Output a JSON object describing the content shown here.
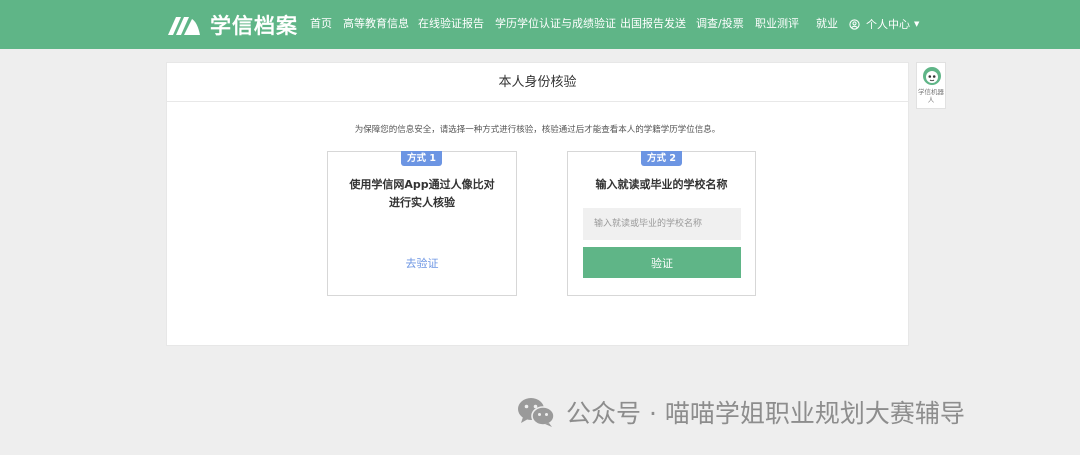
{
  "brand": {
    "name": "学信档案",
    "color": "#5fb587"
  },
  "nav": {
    "items": [
      {
        "id": "home",
        "label": "首页"
      },
      {
        "id": "higher-edu",
        "label": "高等教育信息"
      },
      {
        "id": "online-report",
        "label": "在线验证报告"
      },
      {
        "id": "cert",
        "label": "学历学位认证与成绩验证"
      },
      {
        "id": "abroad",
        "label": "出国报告发送"
      },
      {
        "id": "survey",
        "label": "调查/投票"
      },
      {
        "id": "career",
        "label": "职业测评"
      },
      {
        "id": "job",
        "label": "就业"
      }
    ],
    "user_menu": {
      "label": "个人中心",
      "icon": "user-circle-icon"
    }
  },
  "page": {
    "title": "本人身份核验",
    "notice": "为保障您的信息安全，请选择一种方式进行核验，核验通过后才能查看本人的学籍学历学位信息。"
  },
  "methods": [
    {
      "badge": "方式 1",
      "title": "使用学信网App通过人像比对进行实人核验",
      "link": "去验证"
    },
    {
      "badge": "方式 2",
      "title": "输入就读或毕业的学校名称",
      "placeholder": "输入就读或毕业的学校名称",
      "button": "验证"
    }
  ],
  "robot": {
    "label": "学信机器人",
    "icon": "robot-icon"
  },
  "watermark": {
    "text": "公众号 · 喵喵学姐职业规划大赛辅导",
    "icon": "wechat-icon"
  },
  "colors": {
    "accent": "#5fb587",
    "badge": "#6c95e3",
    "background": "#eeeeee"
  }
}
